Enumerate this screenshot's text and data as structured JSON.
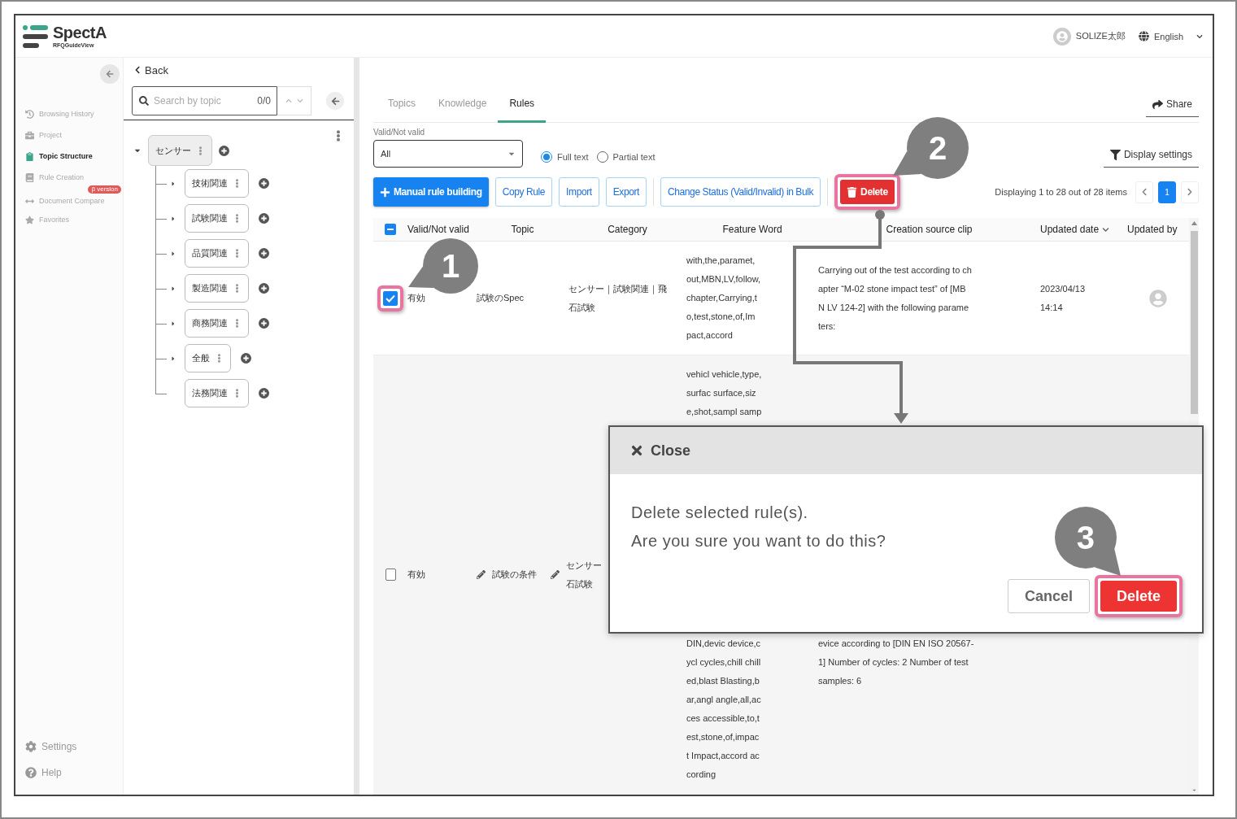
{
  "app": {
    "name": "SpectA",
    "subtitle": "RFQGuideView"
  },
  "user": {
    "name": "SOLIZE太郎"
  },
  "language": "English",
  "nav": {
    "items": [
      {
        "label": "Browsing History",
        "selected": false
      },
      {
        "label": "Project",
        "selected": false
      },
      {
        "label": "Topic Structure",
        "selected": true
      },
      {
        "label": "Rule Creation",
        "selected": false
      },
      {
        "label": "Document Compare",
        "selected": false,
        "badge": "β version"
      },
      {
        "label": "Favorites",
        "selected": false
      }
    ],
    "footer": [
      {
        "label": "Settings"
      },
      {
        "label": "Help"
      }
    ]
  },
  "tree_panel": {
    "back": "Back",
    "search": {
      "placeholder": "Search by topic",
      "count": "0/0"
    },
    "tree": {
      "label": "センサー",
      "expanded": true,
      "children": [
        {
          "label": "技術関連",
          "kind": "branch"
        },
        {
          "label": "試験関連",
          "kind": "branch"
        },
        {
          "label": "品質関連",
          "kind": "branch"
        },
        {
          "label": "製造関連",
          "kind": "branch"
        },
        {
          "label": "商務関連",
          "kind": "branch"
        },
        {
          "label": "全般",
          "kind": "branch"
        },
        {
          "label": "法務関連",
          "kind": "leaf"
        }
      ]
    }
  },
  "tabs": [
    {
      "label": "Topics",
      "selected": false
    },
    {
      "label": "Knowledge",
      "selected": false
    },
    {
      "label": "Rules",
      "selected": true
    }
  ],
  "share": "Share",
  "filter": {
    "label": "Valid/Not valid",
    "value": "All"
  },
  "match_modes": [
    {
      "label": "Full text",
      "selected": true
    },
    {
      "label": "Partial text",
      "selected": false
    }
  ],
  "display_settings": "Display settings",
  "toolbar": [
    [
      {
        "label": "Manual rule building",
        "kind": "primary",
        "highlighted": false
      },
      {
        "label": "Copy Rule",
        "kind": "outline",
        "highlighted": false
      },
      {
        "label": "Import",
        "kind": "outline",
        "highlighted": false
      },
      {
        "label": "Export",
        "kind": "outline",
        "highlighted": false
      }
    ],
    [
      {
        "label": "Change Status (Valid/Invalid) in Bulk",
        "kind": "outline",
        "highlighted": false
      }
    ],
    [
      {
        "label": "Delete",
        "kind": "danger",
        "highlighted": true,
        "callout": "2"
      }
    ]
  ],
  "pagination": {
    "summary": "Displaying 1 to 28 out of 28 items",
    "pages": [
      {
        "label": "1",
        "selected": true
      }
    ]
  },
  "table": {
    "select_all_indeterminate": true,
    "columns": [
      {
        "label": "Valid/Not valid",
        "sorted": false
      },
      {
        "label": "Topic",
        "sorted": false
      },
      {
        "label": "Category",
        "sorted": false
      },
      {
        "label": "Feature Word",
        "sorted": false
      },
      {
        "label": "Creation source clip",
        "sorted": false
      },
      {
        "label": "Updated date",
        "sorted": true
      },
      {
        "label": "Updated by",
        "sorted": false
      }
    ],
    "rows": [
      {
        "checked": true,
        "highlighted": true,
        "callout": "1",
        "hovered": false,
        "valid": "有効",
        "topic": "試験のSpec",
        "category": [
          "センサー｜試験関連｜飛",
          "石試験"
        ],
        "feature_word": [
          "with,the,paramet,",
          "out,MBN,LV,follow,",
          "chapter,Carrying,t",
          "o,test,stone,of,Im",
          "pact,accord"
        ],
        "creation_clip": [
          "Carrying out of the test according to ch",
          "apter “M-02 stone impact test” of [MB",
          "N LV 124-2] with the following parame",
          "ters:"
        ],
        "updated_date": "2023/04/13 14:14"
      },
      {
        "checked": false,
        "highlighted": false,
        "hovered": true,
        "valid": "有効",
        "topic": "試験の条件",
        "category": [
          "センサー",
          "石試験"
        ],
        "feature_word_above": [
          "vehicl vehicle,type,",
          "surfac surface,siz",
          "e,shot,sampl samp"
        ],
        "feature_word_below": [
          "DIN,devic device,c",
          "ycl cycles,chill chill",
          "ed,blast Blasting,b",
          "ar,angl angle,all,ac",
          "ces accessible,to,t",
          "est,stone,of,impac",
          "t Impact,accord ac",
          "cording"
        ],
        "creation_clip_below": [
          "evice according to [DIN EN ISO 20567-",
          "1] Number of cycles: 2 Number of test",
          "samples: 6"
        ]
      }
    ]
  },
  "dialog": {
    "close": "Close",
    "message": [
      "Delete selected rule(s).",
      "Are you sure you want to do this?"
    ],
    "buttons": [
      {
        "label": "Cancel",
        "kind": "secondary",
        "highlighted": false
      },
      {
        "label": "Delete",
        "kind": "danger",
        "highlighted": true,
        "callout": "3"
      }
    ]
  }
}
